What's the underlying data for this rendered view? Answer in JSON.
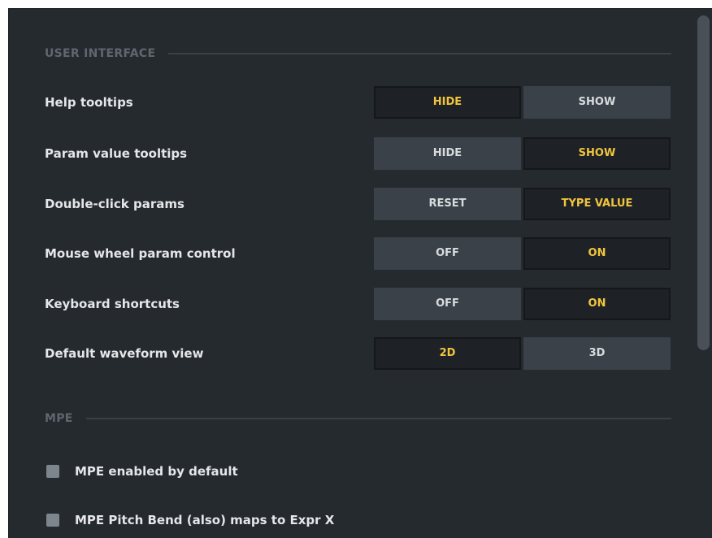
{
  "sections": {
    "ui_title": "USER INTERFACE",
    "mpe_title": "MPE"
  },
  "settings": [
    {
      "label": "Help tooltips",
      "left": "HIDE",
      "right": "SHOW",
      "selected": "left"
    },
    {
      "label": "Param value tooltips",
      "left": "HIDE",
      "right": "SHOW",
      "selected": "right"
    },
    {
      "label": "Double-click params",
      "left": "RESET",
      "right": "TYPE VALUE",
      "selected": "right"
    },
    {
      "label": "Mouse wheel param control",
      "left": "OFF",
      "right": "ON",
      "selected": "right"
    },
    {
      "label": "Keyboard shortcuts",
      "left": "OFF",
      "right": "ON",
      "selected": "right"
    },
    {
      "label": "Default waveform view",
      "left": "2D",
      "right": "3D",
      "selected": "left"
    }
  ],
  "mpe": [
    {
      "label": "MPE enabled by default",
      "checked": false
    },
    {
      "label": "MPE Pitch Bend (also) maps to Expr X",
      "checked": false
    }
  ],
  "colors": {
    "panel_bg": "#252a2f",
    "active_text": "#f2c53d",
    "inactive_button": "#3a4148",
    "active_button": "#1e2226"
  }
}
